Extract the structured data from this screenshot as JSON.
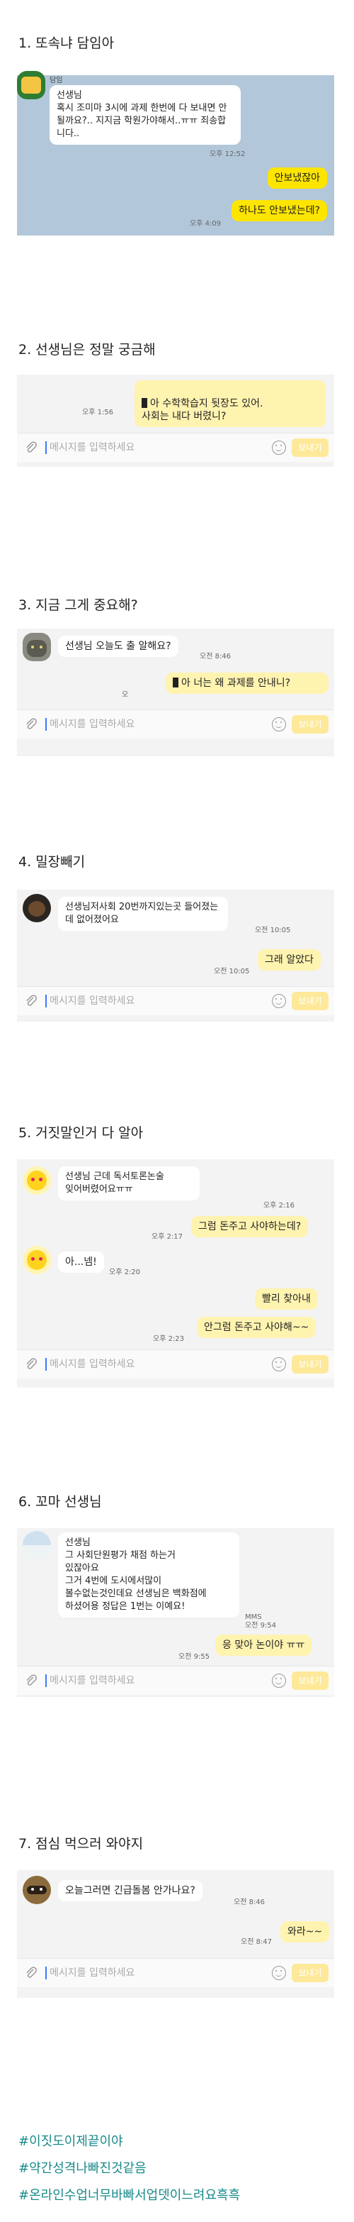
{
  "input_bar": {
    "placeholder": "메시지를 입력하세요",
    "send_label": "보내기"
  },
  "sections": [
    {
      "title": "1. 또속냐 담임아",
      "sender_name": "담임",
      "messages": [
        {
          "text": "선생님\n혹시 조미마 3시에 과제 한번에 다 보내면 안될까요?.. 지지금 학원가야해서..ㅠㅠ 죄송합니다..",
          "time": "오후 12:52"
        },
        {
          "text": "안보냈잖아",
          "time": ""
        },
        {
          "text": "하나도 안보냈는데?",
          "time": "오후 4:09"
        }
      ]
    },
    {
      "title": "2. 선생님은 정말 궁금해",
      "messages": [
        {
          "text": "아 수학학습지 뒷장도 있어.\n사회는 내다 버렸니?",
          "time": "오후 1:56"
        }
      ]
    },
    {
      "title": "3. 지금 그게 중요해?",
      "messages": [
        {
          "text": "선생님 오늘도 출 알해요?",
          "time": "오전 8:46"
        },
        {
          "text": "아 너는 왜 과제를 안내니?",
          "time": "오"
        }
      ]
    },
    {
      "title": "4. 밀장빼기",
      "messages": [
        {
          "text": "선생님저사회 20번까지있는곳 들어졌는데 없어졌어요",
          "time": "오전 10:05"
        },
        {
          "text": "그래 알았다",
          "time": "오전 10:05"
        }
      ]
    },
    {
      "title": "5. 거짓말인거 다 알아",
      "messages": [
        {
          "text": "선생님 근데 독서토론논술\n잊어버렸어요ㅠㅠ",
          "time": "오후 2:16"
        },
        {
          "text": "그럼 돈주고 사야하는데?",
          "time": "오후 2:17"
        },
        {
          "text": "아...넴!",
          "time": "오후 2:20"
        },
        {
          "text": "빨리 찾아내",
          "time": ""
        },
        {
          "text": "안그럼 돈주고 사야해~~",
          "time": "오후 2:23"
        }
      ]
    },
    {
      "title": "6. 꼬마 선생님",
      "messages": [
        {
          "text": "선생님\n그 사회단원평가 채점 하는거\n있잖아요\n그거 4번에 도시에서많이\n볼수없는것인데요 선생님은 백화점에\n하셨어용 정답은 1번는 이예요!",
          "time": "MMS\n오전 9:54"
        },
        {
          "text": "응 맞아 논이야 ㅠㅠ",
          "time": "오전 9:55"
        }
      ]
    },
    {
      "title": "7. 점심 먹으러 와야지",
      "messages": [
        {
          "text": "오늘그러면 긴급돌봄 안가나요?",
          "time": "오전 8:46"
        },
        {
          "text": "와라~~",
          "time": "오전 8:47"
        }
      ]
    }
  ],
  "hashtags": [
    "#이짓도이제끝이야",
    "#약간성격나빠진것같음",
    "#온라인수업너무바빠서업뎃이느려요흑흑"
  ],
  "colors": {
    "kakao_yellow": "#fee500",
    "chat_bg_blue": "#b2c7d9",
    "hashtag": "#1a8a8a"
  }
}
